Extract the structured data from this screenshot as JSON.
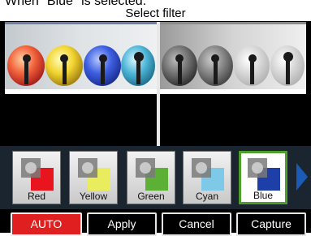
{
  "caption": "When \"Blue\" is selected.",
  "title": "Select filter",
  "filters": [
    {
      "label": "Red",
      "color": "#e8141e",
      "selected": false
    },
    {
      "label": "Yellow",
      "color": "#e9ec5c",
      "selected": false
    },
    {
      "label": "Green",
      "color": "#5cb035",
      "selected": false
    },
    {
      "label": "Cyan",
      "color": "#7ec8e8",
      "selected": false
    },
    {
      "label": "Blue",
      "color": "#1e3fa8",
      "selected": true
    }
  ],
  "buttons": {
    "auto": "AUTO",
    "apply": "Apply",
    "cancel": "Cancel",
    "capture": "Capture"
  },
  "colors": {
    "selected_border": "#4f9d2a",
    "auto_active": "#e02020",
    "next_arrow": "#1b5bb5"
  }
}
